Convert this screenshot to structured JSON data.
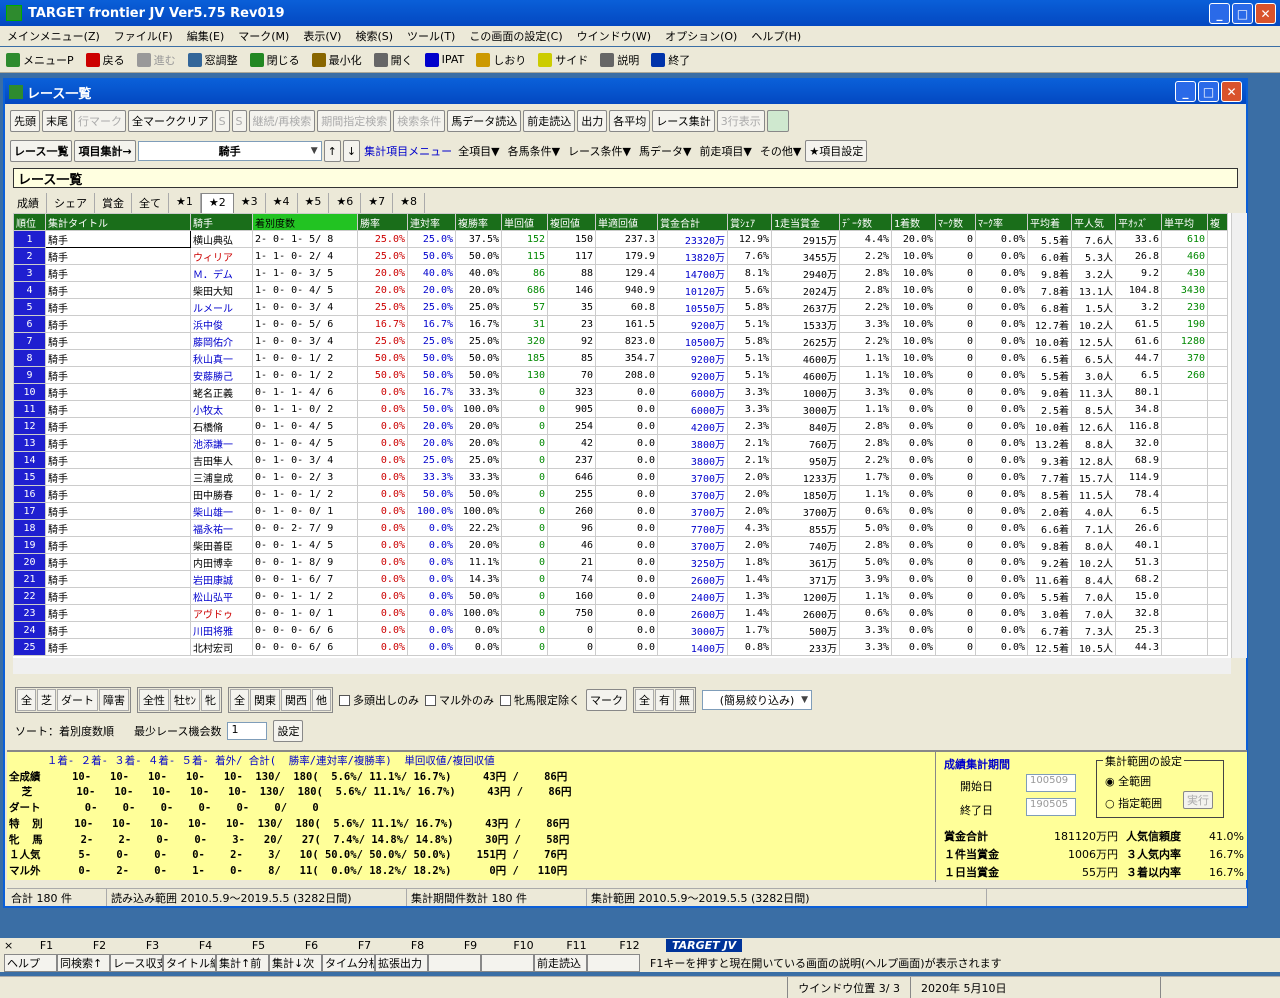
{
  "app": {
    "title": "TARGET frontier JV  Ver5.75  Rev019"
  },
  "menu": [
    "メインメニュー(Z)",
    "ファイル(F)",
    "編集(E)",
    "マーク(M)",
    "表示(V)",
    "検索(S)",
    "ツール(T)",
    "この画面の設定(C)",
    "ウインドウ(W)",
    "オプション(O)",
    "ヘルプ(H)"
  ],
  "toolbar": [
    {
      "label": "メニューP",
      "icon": "menu-icon",
      "color": "#2e8b2e",
      "enabled": true
    },
    {
      "label": "戻る",
      "icon": "back-arrow-icon",
      "color": "#cc0000",
      "enabled": true
    },
    {
      "label": "進む",
      "icon": "forward-arrow-icon",
      "color": "#999999",
      "enabled": false
    },
    {
      "label": "窓調整",
      "icon": "window-adjust-icon",
      "color": "#336699",
      "enabled": true
    },
    {
      "label": "閉じる",
      "icon": "close-door-icon",
      "color": "#228822",
      "enabled": true
    },
    {
      "label": "最小化",
      "icon": "minimize-icon",
      "color": "#886600",
      "enabled": true
    },
    {
      "label": "開く",
      "icon": "open-icon",
      "color": "#666666",
      "enabled": true
    },
    {
      "label": "IPAT",
      "icon": "ipat-icon",
      "color": "#0000cc",
      "enabled": true
    },
    {
      "label": "しおり",
      "icon": "bookmark-icon",
      "color": "#cc9900",
      "enabled": true
    },
    {
      "label": "サイド",
      "icon": "side-icon",
      "color": "#cccc00",
      "enabled": true
    },
    {
      "label": "説明",
      "icon": "help-icon",
      "color": "#666666",
      "enabled": true
    },
    {
      "label": "終了",
      "icon": "exit-icon",
      "color": "#0033aa",
      "enabled": true
    }
  ],
  "window": {
    "title": "レース一覧"
  },
  "buttons_row1": [
    {
      "label": "先頭",
      "enabled": true
    },
    {
      "label": "末尾",
      "enabled": true
    },
    {
      "label": "行マーク",
      "enabled": false
    },
    {
      "label": "全マーククリア",
      "enabled": true
    },
    {
      "label": "S",
      "enabled": false
    },
    {
      "label": "S",
      "enabled": false
    },
    {
      "label": "継続/再検索",
      "enabled": false
    },
    {
      "label": "期間指定検索",
      "enabled": false
    },
    {
      "label": "検索条件",
      "enabled": false
    },
    {
      "label": "馬データ読込",
      "enabled": true
    },
    {
      "label": "前走読込",
      "enabled": true
    },
    {
      "label": "出力",
      "enabled": true
    },
    {
      "label": "各平均",
      "enabled": true
    },
    {
      "label": "レース集計",
      "enabled": true
    },
    {
      "label": "3行表示",
      "enabled": false
    }
  ],
  "row2": {
    "race_list": "レース一覧",
    "item_agg": "項目集計→",
    "select_value": "騎手",
    "up": "↑",
    "down": "↓",
    "menu_label": "集計項目メニュー",
    "dropdowns": [
      "全項目▼",
      "各馬条件▼",
      "レース条件▼",
      "馬データ▼",
      "前走項目▼",
      "その他▼"
    ],
    "item_setting": "★項目設定"
  },
  "list_title": "レース一覧",
  "tabs": [
    "成績",
    "シェア",
    "賞金",
    "全て",
    "★1",
    "★2",
    "★3",
    "★4",
    "★5",
    "★6",
    "★7",
    "★8"
  ],
  "active_tab": "★2",
  "columns": [
    "順位",
    "集計タイトル",
    "騎手",
    "着別度数",
    "勝率",
    "連対率",
    "複勝率",
    "単回値",
    "複回値",
    "単適回値",
    "賞金合計",
    "賞ｼｪｱ",
    "1走当賞金",
    "ﾃﾞｰﾀ数",
    "1着数",
    "ﾏｰｸ数",
    "ﾏｰｸ率",
    "平均着",
    "平人気",
    "平ｵｯｽﾞ",
    "単平均",
    "複"
  ],
  "rows": [
    [
      "1",
      "騎手",
      "横山典弘",
      "2- 0- 1- 5/ 8",
      "25.0%",
      "25.0%",
      "37.5%",
      "152",
      "150",
      "237.3",
      "23320万",
      "12.9%",
      "2915万",
      "4.4%",
      "20.0%",
      "0",
      "0.0%",
      "5.5着",
      "7.6人",
      "33.6",
      "610"
    ],
    [
      "2",
      "騎手",
      "ウィリア",
      "1- 1- 0- 2/ 4",
      "25.0%",
      "50.0%",
      "50.0%",
      "115",
      "117",
      "179.9",
      "13820万",
      "7.6%",
      "3455万",
      "2.2%",
      "10.0%",
      "0",
      "0.0%",
      "6.0着",
      "5.3人",
      "26.8",
      "460"
    ],
    [
      "3",
      "騎手",
      "Ｍ．デム",
      "1- 1- 0- 3/ 5",
      "20.0%",
      "40.0%",
      "40.0%",
      "86",
      "88",
      "129.4",
      "14700万",
      "8.1%",
      "2940万",
      "2.8%",
      "10.0%",
      "0",
      "0.0%",
      "9.8着",
      "3.2人",
      "9.2",
      "430"
    ],
    [
      "4",
      "騎手",
      "柴田大知",
      "1- 0- 0- 4/ 5",
      "20.0%",
      "20.0%",
      "20.0%",
      "686",
      "146",
      "940.9",
      "10120万",
      "5.6%",
      "2024万",
      "2.8%",
      "10.0%",
      "0",
      "0.0%",
      "7.8着",
      "13.1人",
      "104.8",
      "3430"
    ],
    [
      "5",
      "騎手",
      "ルメール",
      "1- 0- 0- 3/ 4",
      "25.0%",
      "25.0%",
      "25.0%",
      "57",
      "35",
      "60.8",
      "10550万",
      "5.8%",
      "2637万",
      "2.2%",
      "10.0%",
      "0",
      "0.0%",
      "6.8着",
      "1.5人",
      "3.2",
      "230"
    ],
    [
      "6",
      "騎手",
      "浜中俊",
      "1- 0- 0- 5/ 6",
      "16.7%",
      "16.7%",
      "16.7%",
      "31",
      "23",
      "161.5",
      "9200万",
      "5.1%",
      "1533万",
      "3.3%",
      "10.0%",
      "0",
      "0.0%",
      "12.7着",
      "10.2人",
      "61.5",
      "190"
    ],
    [
      "7",
      "騎手",
      "藤岡佑介",
      "1- 0- 0- 3/ 4",
      "25.0%",
      "25.0%",
      "25.0%",
      "320",
      "92",
      "823.0",
      "10500万",
      "5.8%",
      "2625万",
      "2.2%",
      "10.0%",
      "0",
      "0.0%",
      "10.0着",
      "12.5人",
      "61.6",
      "1280"
    ],
    [
      "8",
      "騎手",
      "秋山真一",
      "1- 0- 0- 1/ 2",
      "50.0%",
      "50.0%",
      "50.0%",
      "185",
      "85",
      "354.7",
      "9200万",
      "5.1%",
      "4600万",
      "1.1%",
      "10.0%",
      "0",
      "0.0%",
      "6.5着",
      "6.5人",
      "44.7",
      "370"
    ],
    [
      "9",
      "騎手",
      "安藤勝己",
      "1- 0- 0- 1/ 2",
      "50.0%",
      "50.0%",
      "50.0%",
      "130",
      "70",
      "208.0",
      "9200万",
      "5.1%",
      "4600万",
      "1.1%",
      "10.0%",
      "0",
      "0.0%",
      "5.5着",
      "3.0人",
      "6.5",
      "260"
    ],
    [
      "10",
      "騎手",
      "蛯名正義",
      "0- 1- 1- 4/ 6",
      "0.0%",
      "16.7%",
      "33.3%",
      "0",
      "323",
      "0.0",
      "6000万",
      "3.3%",
      "1000万",
      "3.3%",
      "0.0%",
      "0",
      "0.0%",
      "9.0着",
      "11.3人",
      "80.1",
      ""
    ],
    [
      "11",
      "騎手",
      "小牧太",
      "0- 1- 1- 0/ 2",
      "0.0%",
      "50.0%",
      "100.0%",
      "0",
      "905",
      "0.0",
      "6000万",
      "3.3%",
      "3000万",
      "1.1%",
      "0.0%",
      "0",
      "0.0%",
      "2.5着",
      "8.5人",
      "34.8",
      ""
    ],
    [
      "12",
      "騎手",
      "石橋脩",
      "0- 1- 0- 4/ 5",
      "0.0%",
      "20.0%",
      "20.0%",
      "0",
      "254",
      "0.0",
      "4200万",
      "2.3%",
      "840万",
      "2.8%",
      "0.0%",
      "0",
      "0.0%",
      "10.0着",
      "12.6人",
      "116.8",
      ""
    ],
    [
      "13",
      "騎手",
      "池添謙一",
      "0- 1- 0- 4/ 5",
      "0.0%",
      "20.0%",
      "20.0%",
      "0",
      "42",
      "0.0",
      "3800万",
      "2.1%",
      "760万",
      "2.8%",
      "0.0%",
      "0",
      "0.0%",
      "13.2着",
      "8.8人",
      "32.0",
      ""
    ],
    [
      "14",
      "騎手",
      "吉田隼人",
      "0- 1- 0- 3/ 4",
      "0.0%",
      "25.0%",
      "25.0%",
      "0",
      "237",
      "0.0",
      "3800万",
      "2.1%",
      "950万",
      "2.2%",
      "0.0%",
      "0",
      "0.0%",
      "9.3着",
      "12.8人",
      "68.9",
      ""
    ],
    [
      "15",
      "騎手",
      "三浦皇成",
      "0- 1- 0- 2/ 3",
      "0.0%",
      "33.3%",
      "33.3%",
      "0",
      "646",
      "0.0",
      "3700万",
      "2.0%",
      "1233万",
      "1.7%",
      "0.0%",
      "0",
      "0.0%",
      "7.7着",
      "15.7人",
      "114.9",
      ""
    ],
    [
      "16",
      "騎手",
      "田中勝春",
      "0- 1- 0- 1/ 2",
      "0.0%",
      "50.0%",
      "50.0%",
      "0",
      "255",
      "0.0",
      "3700万",
      "2.0%",
      "1850万",
      "1.1%",
      "0.0%",
      "0",
      "0.0%",
      "8.5着",
      "11.5人",
      "78.4",
      ""
    ],
    [
      "17",
      "騎手",
      "柴山雄一",
      "0- 1- 0- 0/ 1",
      "0.0%",
      "100.0%",
      "100.0%",
      "0",
      "260",
      "0.0",
      "3700万",
      "2.0%",
      "3700万",
      "0.6%",
      "0.0%",
      "0",
      "0.0%",
      "2.0着",
      "4.0人",
      "6.5",
      ""
    ],
    [
      "18",
      "騎手",
      "福永祐一",
      "0- 0- 2- 7/ 9",
      "0.0%",
      "0.0%",
      "22.2%",
      "0",
      "96",
      "0.0",
      "7700万",
      "4.3%",
      "855万",
      "5.0%",
      "0.0%",
      "0",
      "0.0%",
      "6.6着",
      "7.1人",
      "26.6",
      ""
    ],
    [
      "19",
      "騎手",
      "柴田善臣",
      "0- 0- 1- 4/ 5",
      "0.0%",
      "0.0%",
      "20.0%",
      "0",
      "46",
      "0.0",
      "3700万",
      "2.0%",
      "740万",
      "2.8%",
      "0.0%",
      "0",
      "0.0%",
      "9.8着",
      "8.0人",
      "40.1",
      ""
    ],
    [
      "20",
      "騎手",
      "内田博幸",
      "0- 0- 1- 8/ 9",
      "0.0%",
      "0.0%",
      "11.1%",
      "0",
      "21",
      "0.0",
      "3250万",
      "1.8%",
      "361万",
      "5.0%",
      "0.0%",
      "0",
      "0.0%",
      "9.2着",
      "10.2人",
      "51.3",
      ""
    ],
    [
      "21",
      "騎手",
      "岩田康誠",
      "0- 0- 1- 6/ 7",
      "0.0%",
      "0.0%",
      "14.3%",
      "0",
      "74",
      "0.0",
      "2600万",
      "1.4%",
      "371万",
      "3.9%",
      "0.0%",
      "0",
      "0.0%",
      "11.6着",
      "8.4人",
      "68.2",
      ""
    ],
    [
      "22",
      "騎手",
      "松山弘平",
      "0- 0- 1- 1/ 2",
      "0.0%",
      "0.0%",
      "50.0%",
      "0",
      "160",
      "0.0",
      "2400万",
      "1.3%",
      "1200万",
      "1.1%",
      "0.0%",
      "0",
      "0.0%",
      "5.5着",
      "7.0人",
      "15.0",
      ""
    ],
    [
      "23",
      "騎手",
      "アヴドゥ",
      "0- 0- 1- 0/ 1",
      "0.0%",
      "0.0%",
      "100.0%",
      "0",
      "750",
      "0.0",
      "2600万",
      "1.4%",
      "2600万",
      "0.6%",
      "0.0%",
      "0",
      "0.0%",
      "3.0着",
      "7.0人",
      "32.8",
      ""
    ],
    [
      "24",
      "騎手",
      "川田将雅",
      "0- 0- 0- 6/ 6",
      "0.0%",
      "0.0%",
      "0.0%",
      "0",
      "0",
      "0.0",
      "3000万",
      "1.7%",
      "500万",
      "3.3%",
      "0.0%",
      "0",
      "0.0%",
      "6.7着",
      "7.3人",
      "25.3",
      ""
    ],
    [
      "25",
      "騎手",
      "北村宏司",
      "0- 0- 0- 6/ 6",
      "0.0%",
      "0.0%",
      "0.0%",
      "0",
      "0",
      "0.0",
      "1400万",
      "0.8%",
      "233万",
      "3.3%",
      "0.0%",
      "0",
      "0.0%",
      "12.5着",
      "10.5人",
      "44.3",
      ""
    ]
  ],
  "filters": {
    "g1": [
      "全",
      "芝",
      "ダート",
      "障害"
    ],
    "g2": [
      "全性",
      "牡ｾﾝ",
      "牝"
    ],
    "g3": [
      "全",
      "関東",
      "関西",
      "他"
    ],
    "chk1": "多頭出しのみ",
    "chk2": "マル外のみ",
    "chk3": "牝馬限定除く",
    "mark_label": "マーク",
    "g4": [
      "全",
      "有",
      "無"
    ],
    "simple_filter": "(簡易絞り込み)"
  },
  "sort": {
    "label": "ソート：着別度数順",
    "min_label": "最少レース機会数",
    "min_value": "1",
    "set": "設定"
  },
  "summary": {
    "header": "      １着- ２着- ３着- ４着- ５着- 着外/ 合計(  勝率/連対率/複勝率)  単回収値/複回収値",
    "lines": [
      "全成績     10-   10-   10-   10-   10-  130/  180(  5.6%/ 11.1%/ 16.7%)     43円 /    86円",
      "  芝       10-   10-   10-   10-   10-  130/  180(  5.6%/ 11.1%/ 16.7%)     43円 /    86円",
      "ダート       0-    0-    0-    0-    0-    0/    0",
      "特  別     10-   10-   10-   10-   10-  130/  180(  5.6%/ 11.1%/ 16.7%)     43円 /    86円",
      "牝  馬      2-    2-    0-    0-    3-   20/   27(  7.4%/ 14.8%/ 14.8%)     30円 /    58円",
      "１人気      5-    0-    0-    0-    2-    3/   10( 50.0%/ 50.0%/ 50.0%)    151円 /    76円",
      "マル外      0-    2-    0-    1-    0-    8/   11(  0.0%/ 18.2%/ 18.2%)      0円 /   110円"
    ],
    "period_title": "成績集計期間",
    "start_label": "開始日",
    "start": "100509",
    "end_label": "終了日",
    "end": "190505",
    "range_title": "集計範囲の設定",
    "range_all": "全範囲",
    "range_spec": "指定範囲",
    "exec": "実行",
    "prize_total_label": "賞金合計",
    "prize_total": "181120万円",
    "per_race_label": "１件当賞金",
    "per_race": "1006万円",
    "per_day_label": "１日当賞金",
    "per_day": "55万円",
    "pop_trust_label": "人気信頼度",
    "pop_trust": "41.0%",
    "top3pop_label": "３人気内率",
    "top3pop": "16.7%",
    "top3fin_label": "３着以内率",
    "top3fin": "16.7%"
  },
  "status": [
    "合計 180 件",
    "読み込み範囲 2010.5.9～2019.5.5 (3282日間)",
    "集計期間件数計 180 件",
    "集計範囲 2010.5.9～2019.5.5 (3282日間)"
  ],
  "fkeys": {
    "labels": [
      "F1",
      "F2",
      "F3",
      "F4",
      "F5",
      "F6",
      "F7",
      "F8",
      "F9",
      "F10",
      "F11",
      "F12"
    ],
    "buttons": [
      "ヘルプ",
      "同検索↑",
      "レース収支",
      "タイトル編集",
      "集計↑前",
      "集計↓次",
      "タイム分析",
      "拡張出力",
      "",
      "",
      "前走読込",
      ""
    ],
    "logo": "TARGET JV",
    "hint": "F1キーを押すと現在開いている画面の説明(ヘルプ画面)が表示されます"
  },
  "bottom": {
    "window_pos": "ウインドウ位置 3/ 3",
    "date": "2020年 5月10日"
  }
}
